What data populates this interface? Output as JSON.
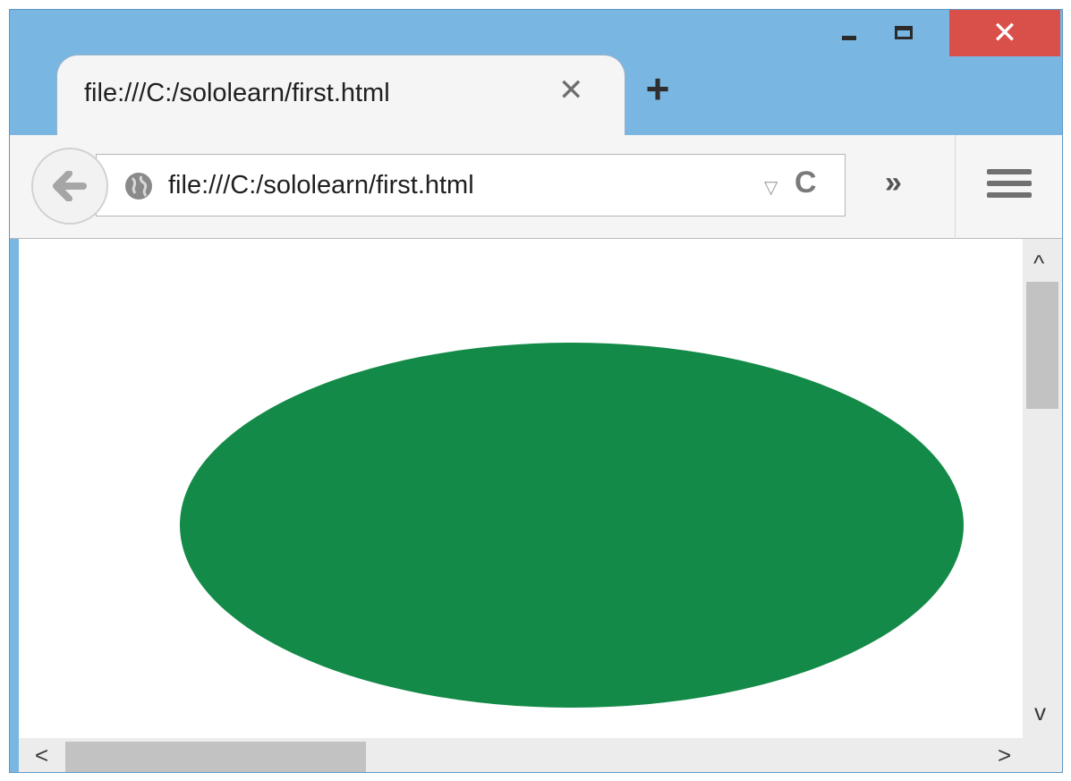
{
  "window": {
    "controls": {
      "minimize": "minimize",
      "maximize": "maximize",
      "close": "close"
    }
  },
  "tab": {
    "title": "file:///C:/sololearn/first.html",
    "close_glyph": "✕",
    "new_tab_glyph": "+"
  },
  "navbar": {
    "url": "file:///C:/sololearn/first.html",
    "back_glyph": "←",
    "reload_glyph": "C",
    "dropdown_glyph": "▽",
    "overflow_glyph": "»"
  },
  "page": {
    "ellipse_color": "#138a47"
  },
  "scrollbars": {
    "up": "^",
    "down": "v",
    "left": "<",
    "right": ">"
  },
  "icons": {
    "back": "back-arrow-icon",
    "globe": "globe-icon",
    "reload": "reload-icon",
    "menu": "hamburger-menu-icon",
    "close": "close-icon"
  }
}
